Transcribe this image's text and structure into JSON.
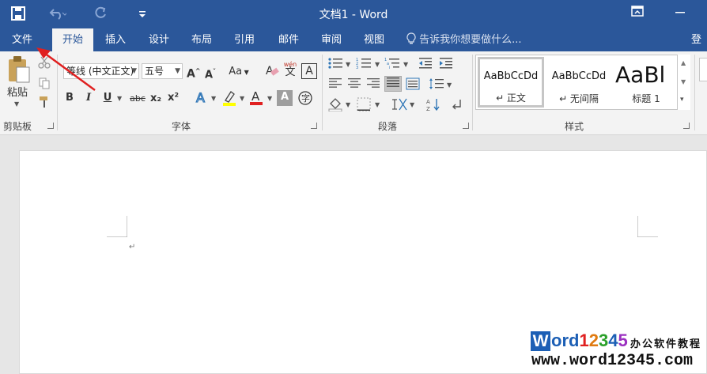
{
  "titlebar": {
    "title": "文档1 - Word",
    "save_icon": "save-icon",
    "undo_icon": "undo-icon",
    "redo_icon": "redo-icon",
    "customize_icon": "customize-quick-access-icon",
    "ribbon_display_icon": "ribbon-display-options-icon",
    "minimize_icon": "minimize-icon"
  },
  "tabs": {
    "file": "文件",
    "home": "开始",
    "insert": "插入",
    "design": "设计",
    "layout": "布局",
    "references": "引用",
    "mailings": "邮件",
    "review": "审阅",
    "view": "视图",
    "tell_me": "告诉我你想要做什么...",
    "login": "登"
  },
  "clipboard": {
    "paste": "粘贴",
    "label": "剪贴板"
  },
  "font": {
    "name": "等线 (中文正文)",
    "size": "五号",
    "case": "Aa",
    "phonetic_top": "wén",
    "phonetic_char": "文",
    "bold": "B",
    "italic": "I",
    "underline": "U",
    "strike": "abc",
    "subscript": "x₂",
    "superscript": "x²",
    "font_color": "A",
    "label": "字体"
  },
  "paragraph": {
    "label": "段落"
  },
  "styles": {
    "items": [
      {
        "preview": "AaBbCcDd",
        "name": "↵ 正文"
      },
      {
        "preview": "AaBbCcDd",
        "name": "↵ 无间隔"
      },
      {
        "preview": "AaBl",
        "name": "标题 1"
      }
    ],
    "label": "样式"
  },
  "watermark": {
    "brand": "Word12345",
    "tagline": "办公软件教程",
    "url": "www.word12345.com"
  },
  "colors": {
    "title_bar": "#2b579a",
    "ribbon": "#f3f3f3",
    "highlight": "#ffff00",
    "font_color": "#e02020",
    "arrow": "#e02020"
  }
}
